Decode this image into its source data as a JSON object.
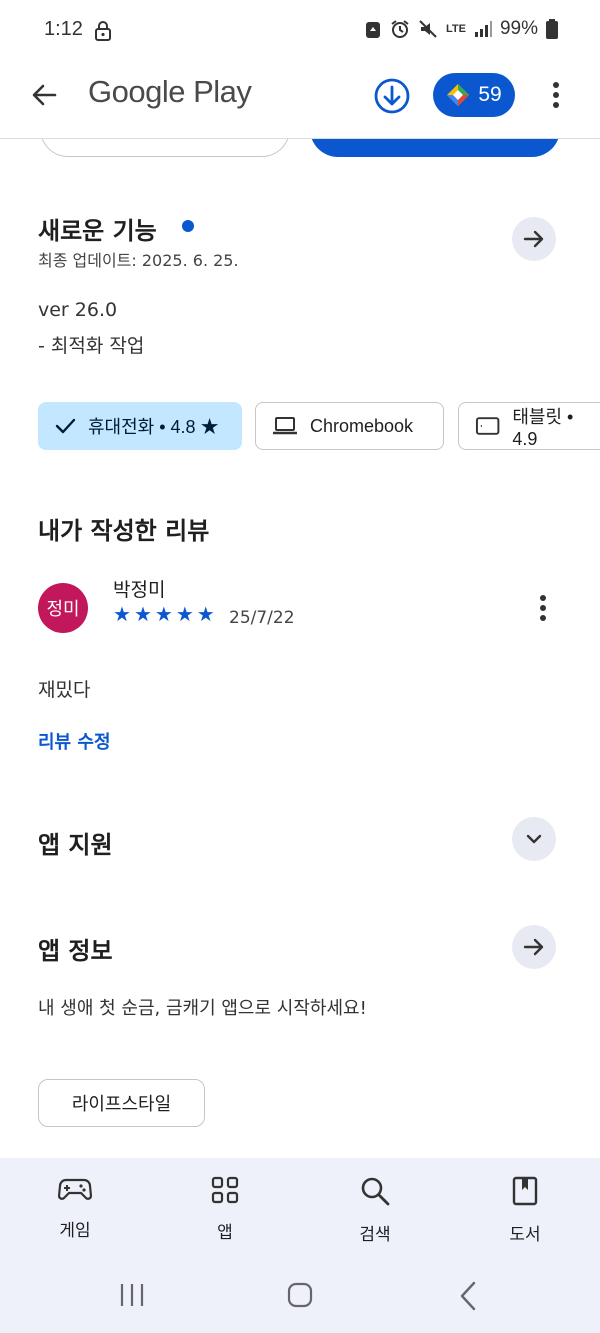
{
  "status_bar": {
    "time": "1:12",
    "battery": "99%",
    "network": "LTE"
  },
  "app_bar": {
    "title": "Google Play",
    "points": "59"
  },
  "whats_new": {
    "title": "새로운 기능",
    "updated": "최종 업데이트: 2025. 6. 25.",
    "version": "ver 26.0",
    "note": "- 최적화 작업"
  },
  "device_chips": [
    {
      "label": "휴대전화 • 4.8 ★"
    },
    {
      "label": "Chromebook"
    },
    {
      "label": "태블릿 • 4.9"
    }
  ],
  "my_review": {
    "section_title": "내가 작성한 리뷰",
    "avatar_text": "정미",
    "author": "박정미",
    "rating": 5,
    "date": "25/7/22",
    "text": "재밌다",
    "edit_label": "리뷰 수정"
  },
  "app_support": {
    "title": "앱 지원"
  },
  "app_info": {
    "title": "앱 정보",
    "description": "내 생애 첫 순금, 금캐기 앱으로 시작하세요!",
    "tag": "라이프스타일"
  },
  "bottom_nav": [
    {
      "label": "게임",
      "icon": "gamepad-icon"
    },
    {
      "label": "앱",
      "icon": "apps-grid-icon"
    },
    {
      "label": "검색",
      "icon": "search-icon"
    },
    {
      "label": "도서",
      "icon": "book-icon"
    }
  ],
  "colors": {
    "accent": "#0b57d0",
    "chip_selected": "#c2e7ff",
    "avatar": "#c2185b",
    "nav_bg": "#eef1fa"
  }
}
